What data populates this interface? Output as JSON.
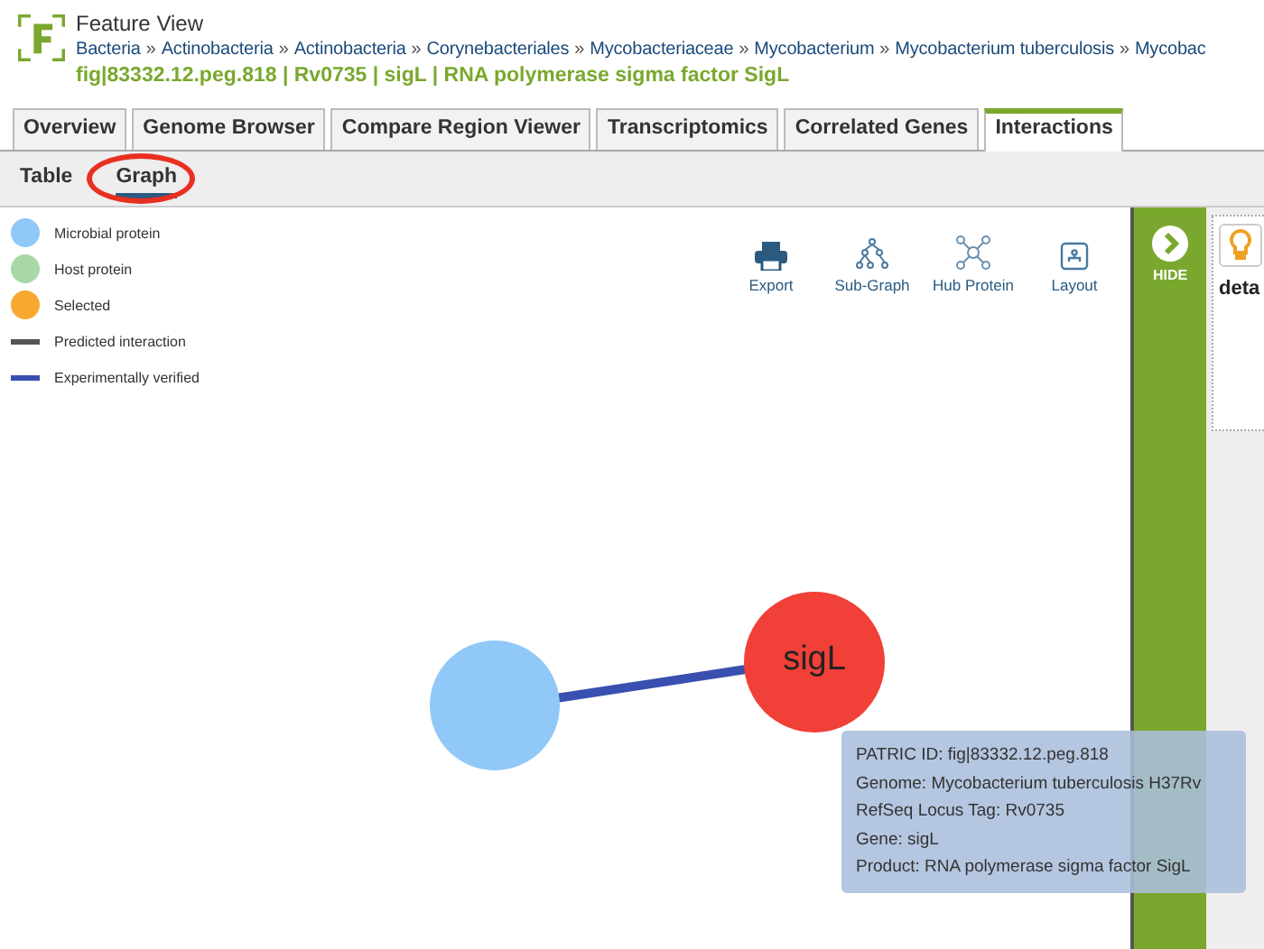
{
  "header": {
    "title": "Feature View",
    "separator": "»",
    "breadcrumb": [
      "Bacteria",
      "Actinobacteria",
      "Actinobacteria",
      "Corynebacteriales",
      "Mycobacteriaceae",
      "Mycobacterium",
      "Mycobacterium tuberculosis",
      "Mycobac"
    ],
    "feature": "fig|83332.12.peg.818 | Rv0735 | sigL | RNA polymerase sigma factor SigL"
  },
  "tabs": [
    {
      "label": "Overview",
      "selected": false
    },
    {
      "label": "Genome Browser",
      "selected": false
    },
    {
      "label": "Compare Region Viewer",
      "selected": false
    },
    {
      "label": "Transcriptomics",
      "selected": false
    },
    {
      "label": "Correlated Genes",
      "selected": false
    },
    {
      "label": "Interactions",
      "selected": true
    }
  ],
  "subtabs": [
    {
      "label": "Table",
      "selected": false
    },
    {
      "label": "Graph",
      "selected": true
    }
  ],
  "legend": [
    {
      "kind": "node",
      "label": "Microbial protein",
      "color": "#90c8f8"
    },
    {
      "kind": "node",
      "label": "Host protein",
      "color": "#a8d8a8"
    },
    {
      "kind": "node",
      "label": "Selected",
      "color": "#f8a830"
    },
    {
      "kind": "edge",
      "label": "Predicted interaction",
      "color": "#555555"
    },
    {
      "kind": "edge",
      "label": "Experimentally verified",
      "color": "#3a50b0"
    }
  ],
  "toolbar": [
    "Export",
    "Sub-Graph",
    "Hub Protein",
    "Layout"
  ],
  "graph": {
    "selected_node": "sigL"
  },
  "tooltip": [
    "PATRIC ID: fig|83332.12.peg.818",
    "Genome: Mycobacterium tuberculosis H37Rv",
    "RefSeq Locus Tag: Rv0735",
    "Gene: sigL",
    "Product: RNA polymerase sigma factor SigL"
  ],
  "side": {
    "hide": "HIDE",
    "panel_text": "deta"
  }
}
